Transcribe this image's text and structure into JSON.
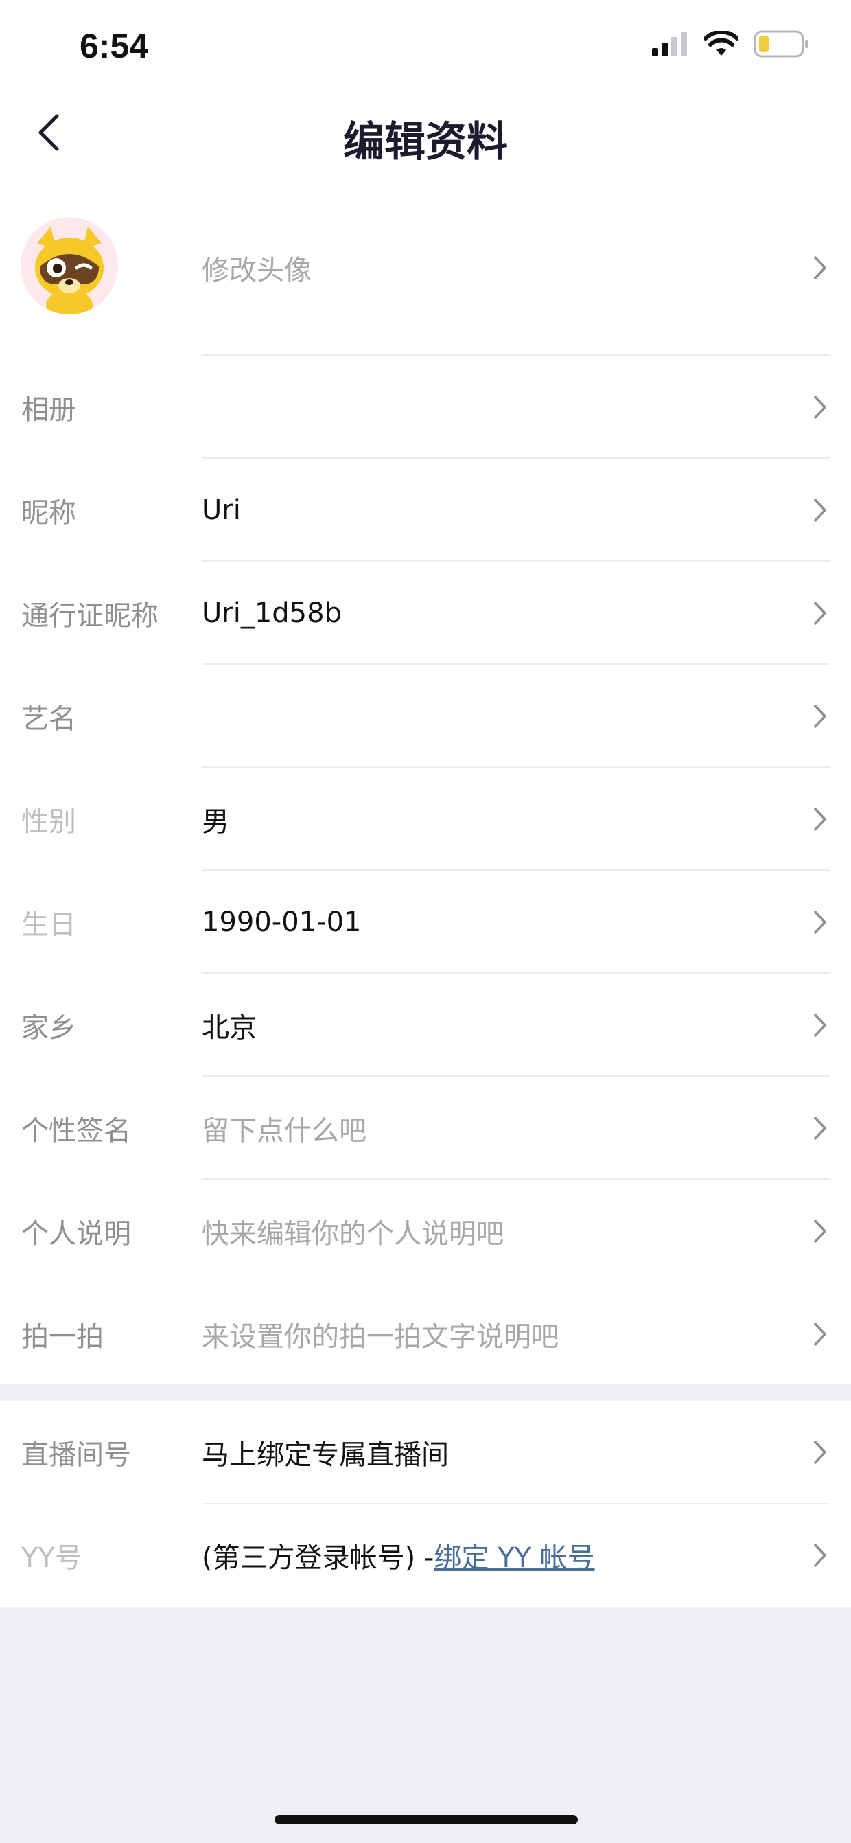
{
  "status_bar": {
    "time": "6:54"
  },
  "header": {
    "title": "编辑资料"
  },
  "profile_rows": [
    {
      "label": "",
      "value": "修改头像",
      "placeholder": true
    },
    {
      "label": "相册",
      "value": ""
    },
    {
      "label": "昵称",
      "value": "Uri"
    },
    {
      "label": "通行证昵称",
      "value": "Uri_1d58b"
    },
    {
      "label": "艺名",
      "value": ""
    },
    {
      "label": "性别",
      "value": "男"
    },
    {
      "label": "生日",
      "value": "1990-01-01"
    },
    {
      "label": "家乡",
      "value": "北京"
    },
    {
      "label": "个性签名",
      "value": "留下点什么吧",
      "placeholder": true
    },
    {
      "label": "个人说明",
      "value": "快来编辑你的个人说明吧",
      "placeholder": true
    },
    {
      "label": "拍一拍",
      "value": "来设置你的拍一拍文字说明吧",
      "placeholder": true
    }
  ],
  "account_rows": [
    {
      "label": "直播间号",
      "value": "马上绑定专属直播间"
    },
    {
      "label": "YY号",
      "value_prefix": "(第三方登录帐号) -",
      "link": "绑定 YY 帐号"
    }
  ],
  "icons": {
    "back": "chevron-left-icon",
    "row_arrow": "chevron-right-icon",
    "avatar": "raccoon-mascot-avatar"
  },
  "colors": {
    "background": "#eff0f4",
    "card": "#ffffff",
    "label": "#8e8e93",
    "value": "#111111",
    "placeholder": "#a6a6ab",
    "link": "#4a6e9a"
  }
}
